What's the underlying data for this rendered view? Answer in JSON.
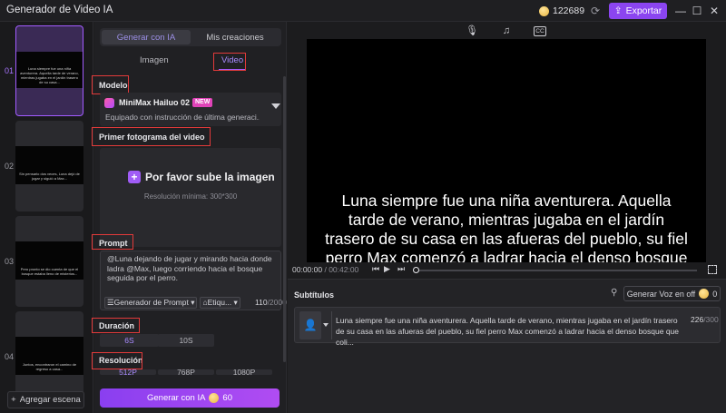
{
  "app": {
    "title": "Generador de Video IA"
  },
  "header": {
    "credits": "122689",
    "export_label": "Exportar"
  },
  "scenes": {
    "items": [
      {
        "number": "01",
        "caption": "Luna siempre fue una niña aventurera. Aquella tarde de verano, mientras jugaba en el jardín trasero de su casa..."
      },
      {
        "number": "02",
        "caption": "Sin pensarlo dos veces, Luna dejó de jugar y siguió a Max..."
      },
      {
        "number": "03",
        "caption": "Pero pronto se dio cuenta de que el bosque estaba lleno de misterios..."
      },
      {
        "number": "04",
        "caption": "Juntos, encontraron el camino de regreso a casa..."
      }
    ],
    "add_label": "Agregar escena"
  },
  "panel": {
    "tabs": [
      "Generar con IA",
      "Mis creaciones"
    ],
    "subtabs": [
      "Imagen",
      "Video"
    ],
    "model_label": "Modelo",
    "model_name": "MiniMax Hailuo 02",
    "model_badge": "NEW",
    "model_desc": "Equipado con instrucción de última generaci...",
    "first_frame_label": "Primer fotograma del video",
    "upload_label": "Por favor sube la imagen",
    "upload_hint": "Resolución mínima: 300*300",
    "prompt_label": "Prompt",
    "prompt_text": "@Luna dejando de jugar y mirando hacia donde ladra @Max, luego corriendo hacia el bosque seguida por el perro.",
    "prompt_generator": "Generador de Prompt",
    "prompt_tags": "Etiqu...",
    "prompt_count": "110",
    "prompt_max": "/2000",
    "duration_label": "Duración",
    "durations": [
      "6S",
      "10S"
    ],
    "resolution_label": "Resolución",
    "resolutions": [
      "512P",
      "768P",
      "1080P"
    ],
    "generate_label": "Generar con IA",
    "generate_cost": "60"
  },
  "player": {
    "caption": "Luna siempre fue una niña aventurera. Aquella tarde de verano, mientras jugaba en el jardín trasero de su casa en las afueras del pueblo, su fiel perro Max comenzó a ladrar hacia el denso bosque que colindaba con su propiedad",
    "current_time": "00:00:00",
    "duration": "/ 00:42:00"
  },
  "subtitles": {
    "title": "Subtítulos",
    "voice_label": "Generar Voz en off",
    "voice_cost": "0",
    "entry_text": "Luna siempre fue una niña aventurera. Aquella tarde de verano, mientras jugaba en el jardín trasero de su casa en las afueras del pueblo, su fiel perro Max comenzó a ladrar hacia el denso bosque que coli...",
    "entry_count": "226",
    "entry_max": "/300"
  }
}
